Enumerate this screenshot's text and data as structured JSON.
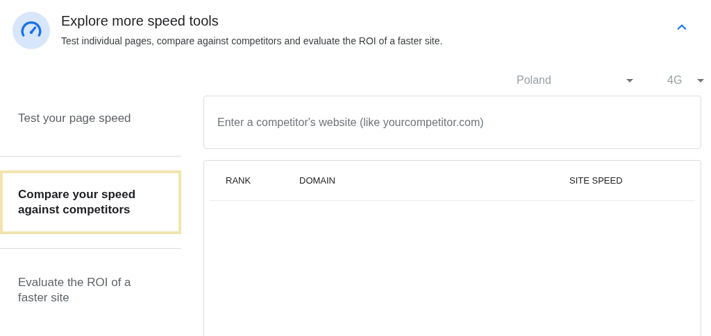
{
  "header": {
    "title": "Explore more speed tools",
    "subtitle": "Test individual pages, compare against competitors and evaluate the ROI of a faster site.",
    "expanded": true
  },
  "filters": [
    {
      "value": "Poland"
    },
    {
      "value": "4G"
    }
  ],
  "menu": [
    {
      "label": "Test your page speed",
      "selected": false
    },
    {
      "label": "Compare your speed against competitors",
      "selected": true
    },
    {
      "label": "Evaluate the ROI of a faster site",
      "selected": false
    }
  ],
  "competitor_input": {
    "placeholder": "Enter a competitor's website (like yourcompetitor.com)"
  },
  "table": {
    "columns": [
      "RANK",
      "DOMAIN",
      "SITE SPEED"
    ]
  }
}
